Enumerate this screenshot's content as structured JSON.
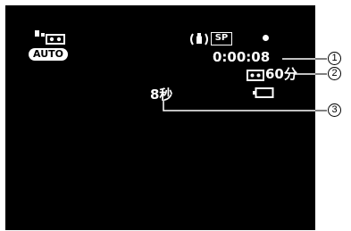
{
  "viewfinder": {
    "mode_badge": "AUTO",
    "record_mode_badge": "SP",
    "timecode": "0:00:08",
    "remaining_tape": "60分",
    "elapsed_indicator": "8秒"
  },
  "callouts": [
    "1",
    "2",
    "3"
  ],
  "colors": {
    "screen_background": "#000000",
    "osd_text": "#ffffff",
    "page_background": "#ffffff"
  },
  "icons": [
    "camera-tape-icon",
    "image-stabilizer-icon",
    "record-dot-icon",
    "tape-cassette-icon",
    "battery-icon"
  ]
}
